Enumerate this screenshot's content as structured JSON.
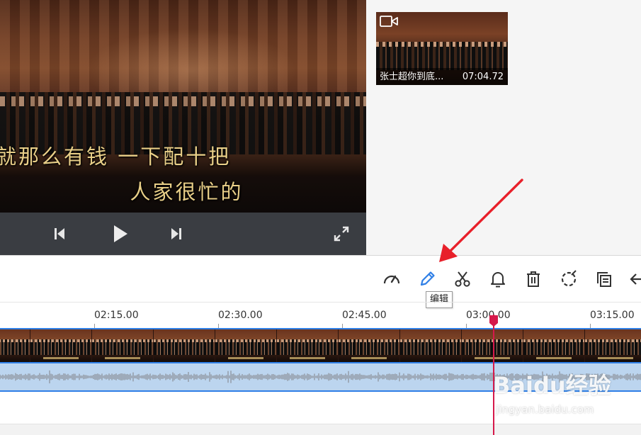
{
  "preview": {
    "subtitle_line1": "就那么有钱 一下配十把",
    "subtitle_line2": "人家很忙的"
  },
  "player_controls": {
    "icons": [
      "previous-icon",
      "play-icon",
      "next-icon",
      "fullscreen-icon"
    ]
  },
  "media_bin": {
    "clip_name": "张士超你到底...",
    "clip_duration": "07:04.72",
    "clip_icon": "video-camera-icon"
  },
  "toolbar": {
    "tools": [
      "speed-icon",
      "edit-icon",
      "scissors-icon",
      "bell-icon",
      "trash-icon",
      "crop-icon",
      "copy-icon",
      "back-icon"
    ],
    "tooltip": "编辑"
  },
  "timeline": {
    "ticks": [
      "02:15.00",
      "02:30.00",
      "02:45.00",
      "03:00.00",
      "03:15.00"
    ],
    "playhead_time": "03:00.00"
  },
  "watermark": {
    "logo": "Baidu经验",
    "url": "jingyan.baidu.com"
  },
  "colors": {
    "track_accent": "#2f7fe6",
    "playhead": "#d6194b",
    "annotation_arrow": "#e8202a",
    "edit_icon_active": "#2f7fe6"
  }
}
